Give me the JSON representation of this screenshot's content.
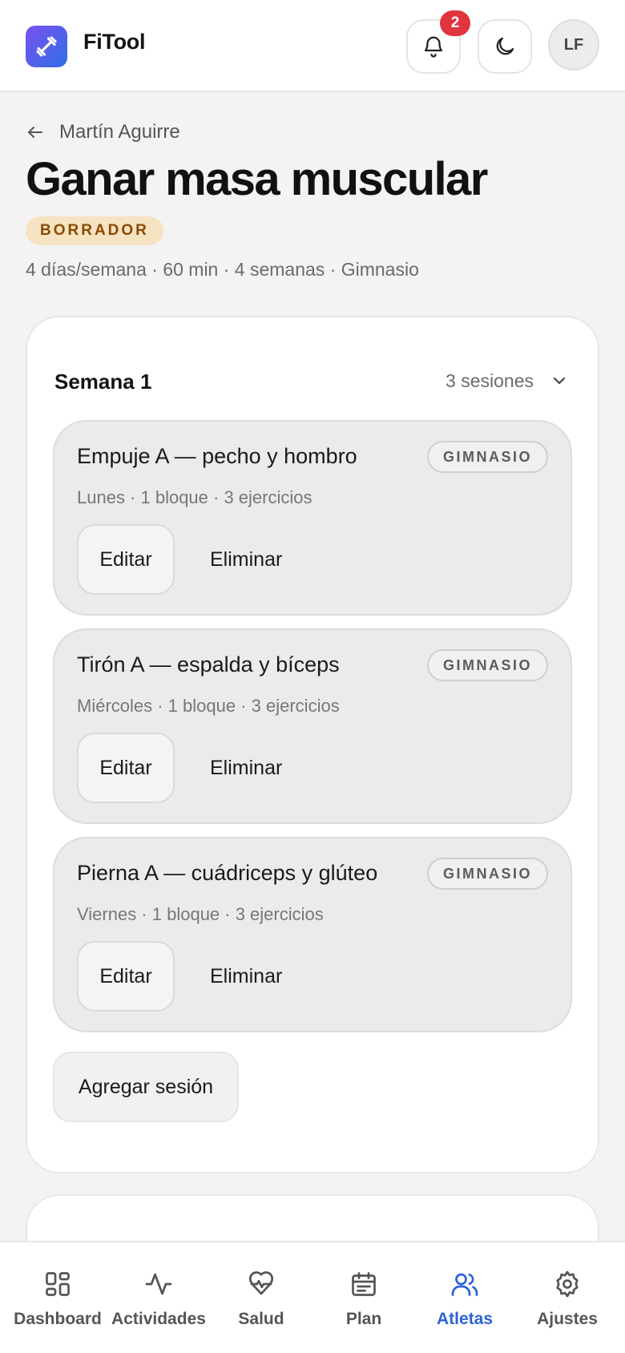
{
  "header": {
    "app_name": "FiTool",
    "notifications_count": "2",
    "user_initials": "LF"
  },
  "breadcrumb": {
    "back_label": "Martín Aguirre"
  },
  "plan": {
    "title": "Ganar masa muscular",
    "status": "BORRADOR",
    "meta": "4 días/semana · 60 min · 4 semanas · Gimnasio"
  },
  "week": {
    "title": "Semana 1",
    "count": "3 sesiones",
    "sessions": [
      {
        "name": "Empuje A — pecho y hombro",
        "tag": "GIMNASIO",
        "meta": "Lunes · 1 bloque · 3 ejercicios",
        "edit_label": "Editar",
        "delete_label": "Eliminar"
      },
      {
        "name": "Tirón A — espalda y bíceps",
        "tag": "GIMNASIO",
        "meta": "Miércoles · 1 bloque · 3 ejercicios",
        "edit_label": "Editar",
        "delete_label": "Eliminar"
      },
      {
        "name": "Pierna A — cuádriceps y glúteo",
        "tag": "GIMNASIO",
        "meta": "Viernes · 1 bloque · 3 ejercicios",
        "edit_label": "Editar",
        "delete_label": "Eliminar"
      }
    ],
    "add_session_label": "Agregar sesión"
  },
  "nav": {
    "items": [
      {
        "label": "Dashboard",
        "icon": "dashboard-icon"
      },
      {
        "label": "Actividades",
        "icon": "activity-icon"
      },
      {
        "label": "Salud",
        "icon": "heart-pulse-icon"
      },
      {
        "label": "Plan",
        "icon": "calendar-icon"
      },
      {
        "label": "Atletas",
        "icon": "users-icon",
        "active": true
      },
      {
        "label": "Ajustes",
        "icon": "gear-icon"
      }
    ]
  },
  "colors": {
    "accent": "#2d63d6",
    "badge_red": "#e0343f",
    "draft_bg": "#f5e3c2",
    "draft_text": "#8a4a00"
  }
}
